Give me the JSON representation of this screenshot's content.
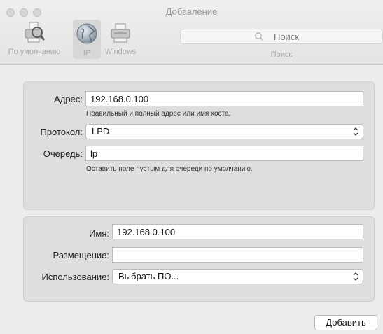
{
  "window": {
    "title": "Добавление"
  },
  "toolbar": {
    "items": [
      {
        "label": "По умолчанию",
        "icon": "default-printer-icon"
      },
      {
        "label": "IP",
        "icon": "globe-icon",
        "selected": true
      },
      {
        "label": "Windows",
        "icon": "windows-printer-icon"
      }
    ],
    "search": {
      "placeholder": "Поиск",
      "label": "Поиск"
    }
  },
  "address_section": {
    "address": {
      "label": "Адрес:",
      "value": "192.168.0.100",
      "hint": "Правильный и полный адрес или имя хоста."
    },
    "protocol": {
      "label": "Протокол:",
      "value": "LPD"
    },
    "queue": {
      "label": "Очередь:",
      "value": "lp",
      "hint": "Оставить поле пустым для очереди по умолчанию."
    }
  },
  "printer_section": {
    "name": {
      "label": "Имя:",
      "value": "192.168.0.100"
    },
    "location": {
      "label": "Размещение:",
      "value": ""
    },
    "use": {
      "label": "Использование:",
      "value": "Выбрать ПО..."
    }
  },
  "actions": {
    "add_label": "Добавить"
  },
  "colors": {
    "window_bg": "#ececec",
    "group_bg": "#dedede",
    "inactive_text": "#a8a8a8"
  }
}
